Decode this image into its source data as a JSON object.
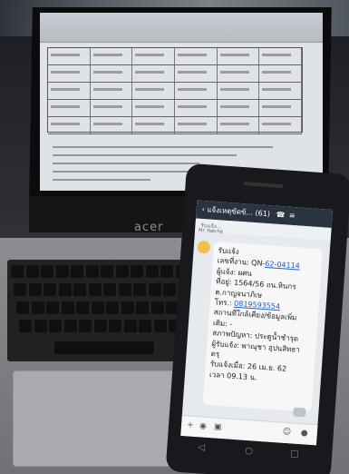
{
  "laptop": {
    "brand": "acer"
  },
  "chat": {
    "title": "แจ้งเหตุขัดข้...",
    "member_count": "(61)",
    "subtitle": "รับแจ้ง...",
    "sender": "Mr. Natcha",
    "lines": {
      "l1": "รับแจ้ง",
      "l2_prefix": "เลขที่งาน: QN-",
      "l2_link": "62-04114",
      "l3": "ผู้แจ้ง: ผศน",
      "l4": "ที่อยู่: 1564/56 ถน.หินกร",
      "l5": "ต.กาญจนาภิเษ",
      "l6_prefix": "โทร.: ",
      "l6_link": "0819593554",
      "l7": "สถานที่ใกล้เคียง/ข้อมูลเพิ่ม",
      "l8": "เติม: -",
      "l9": "สภาพปัญหา: ประตูน้ำชำรุด",
      "l10": "ผู้รับแจ้ง: พาณุชา อุปนสิทธา",
      "l11": "ดรุ",
      "l12": "รับแจ้งเมื่อ: 26 เม.ย. 62",
      "l13": "เวลา 09.13 น."
    }
  },
  "icons": [
    "back-arrow-icon",
    "phone-call-icon",
    "menu-icon",
    "plus-icon",
    "camera-icon",
    "image-icon",
    "emoji-icon",
    "mic-icon",
    "nav-back-icon",
    "nav-home-icon",
    "nav-recent-icon"
  ]
}
